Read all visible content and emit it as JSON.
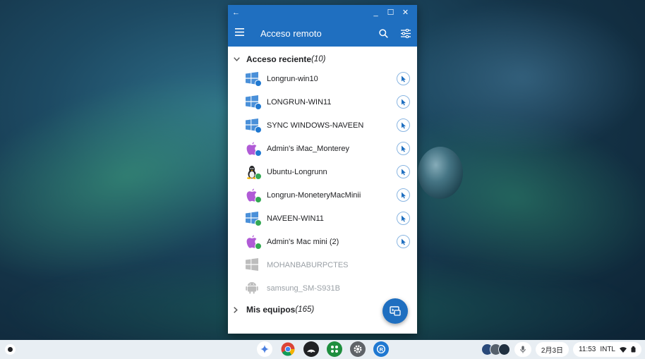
{
  "window": {
    "back_glyph": "←",
    "minimize_glyph": "_",
    "maximize_glyph": "☐",
    "close_glyph": "✕",
    "title": "Acceso remoto"
  },
  "recent": {
    "label": "Acceso reciente",
    "count": "(10)",
    "items": [
      {
        "name": "Longrun-win10",
        "os": "windows-icon",
        "status": "blue"
      },
      {
        "name": "LONGRUN-WIN11",
        "os": "windows-icon",
        "status": "blue"
      },
      {
        "name": "SYNC WINDOWS-NAVEEN",
        "os": "windows-icon",
        "status": "blue"
      },
      {
        "name": "Admin's iMac_Monterey",
        "os": "apple-icon",
        "status": "blue"
      },
      {
        "name": "Ubuntu-Longrunn",
        "os": "linux-icon",
        "status": "green"
      },
      {
        "name": "Longrun-MoneteryMacMinii",
        "os": "apple-icon",
        "status": "green"
      },
      {
        "name": "NAVEEN-WIN11",
        "os": "windows-icon",
        "status": "green"
      },
      {
        "name": "Admin's Mac mini (2)",
        "os": "apple-icon",
        "status": "green"
      },
      {
        "name": "MOHANBABURPCTES",
        "os": "windows-icon",
        "status": "offline"
      },
      {
        "name": "samsung_SM-S931B",
        "os": "android-icon",
        "status": "offline"
      }
    ]
  },
  "devices": {
    "label": "Mis equipos",
    "count": "(165)"
  },
  "shelf": {
    "date": "2月3日",
    "time": "11:53",
    "input_method": "INTL"
  },
  "colors": {
    "accent": "#1f6fc0",
    "online_blue": "#1f78d1",
    "online_green": "#34a853",
    "offline": "#bdbdbd"
  }
}
